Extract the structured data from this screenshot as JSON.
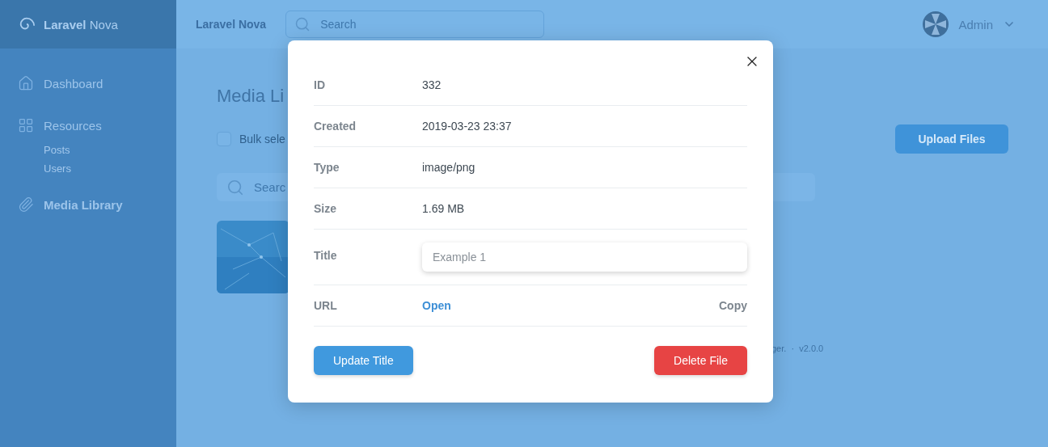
{
  "sidebar": {
    "brand": "**Laravel** Nova",
    "items": [
      {
        "label": "Dashboard",
        "selected": false
      },
      {
        "label": "Resources",
        "selected": false,
        "children": [
          {
            "label": "Posts",
            "selected": false
          },
          {
            "label": "Users",
            "selected": false
          }
        ]
      },
      {
        "label": "Media Library",
        "selected": true
      }
    ]
  },
  "header": {
    "app_name": "Laravel Nova",
    "search": {
      "placeholder": "Search"
    },
    "user": "Admin"
  },
  "page": {
    "title": "Media Li",
    "bulk_select": {
      "label": "Bulk sele",
      "checked": false
    },
    "upload_button": "Upload Files",
    "search": {
      "placeholder": "Searc"
    },
    "footer": "ger.  ·  v2.0.0"
  },
  "modal": {
    "fields": [
      {
        "kind": "text",
        "label": "ID",
        "value": "332"
      },
      {
        "kind": "text",
        "label": "Created",
        "value": "2019-03-23 23:37"
      },
      {
        "kind": "text",
        "label": "Type",
        "value": "image/png"
      },
      {
        "kind": "text",
        "label": "Size",
        "value": "1.69 MB"
      },
      {
        "kind": "input",
        "label": "Title",
        "placeholder": "Example 1"
      },
      {
        "kind": "link",
        "label": "URL",
        "link": "Open",
        "action": "Copy"
      }
    ],
    "buttons": [
      {
        "kind": "primary",
        "label": "Update Title"
      },
      {
        "kind": "danger",
        "label": "Delete File"
      }
    ]
  }
}
